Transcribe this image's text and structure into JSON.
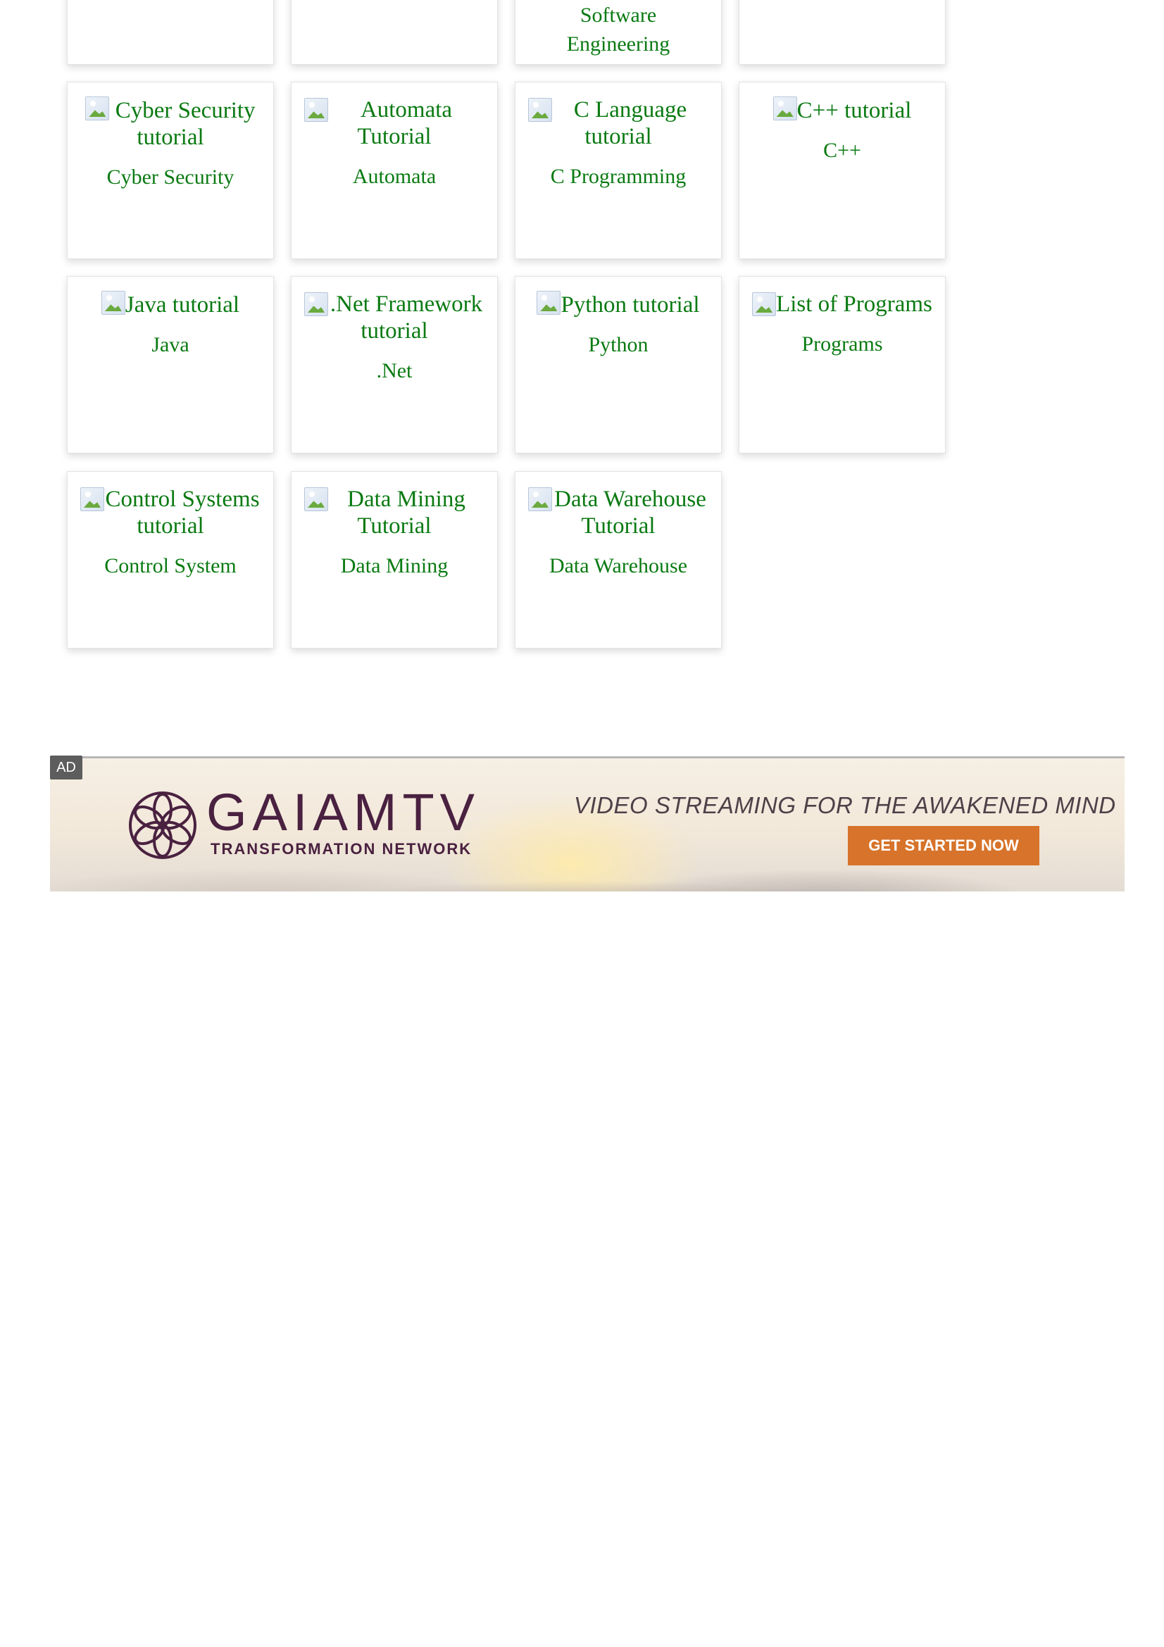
{
  "cards": [
    {
      "img_alt": "",
      "caption": ""
    },
    {
      "img_alt": "",
      "caption": ""
    },
    {
      "img_alt": "",
      "caption": "Software Engineering"
    },
    {
      "img_alt": "",
      "caption": ""
    },
    {
      "img_alt": "Cyber Security tutorial",
      "caption": "Cyber Security"
    },
    {
      "img_alt": "Automata Tutorial",
      "caption": "Automata"
    },
    {
      "img_alt": "C Language tutorial",
      "caption": "C Programming"
    },
    {
      "img_alt": "C++ tutorial",
      "caption": "C++"
    },
    {
      "img_alt": "Java tutorial",
      "caption": "Java"
    },
    {
      "img_alt": ".Net Framework tutorial",
      "caption": ".Net"
    },
    {
      "img_alt": "Python tutorial",
      "caption": "Python"
    },
    {
      "img_alt": "List of Programs",
      "caption": "Programs"
    },
    {
      "img_alt": "Control Systems tutorial",
      "caption": "Control System"
    },
    {
      "img_alt": "Data Mining Tutorial",
      "caption": "Data Mining"
    },
    {
      "img_alt": "Data Warehouse Tutorial",
      "caption": "Data Warehouse"
    }
  ],
  "ad": {
    "badge": "AD",
    "brand": "GAIAMTV",
    "subtitle": "TRANSFORMATION NETWORK",
    "tagline": "VIDEO STREAMING FOR THE AWAKENED MIND",
    "cta": "GET STARTED NOW",
    "brand_color": "#4a2140",
    "cta_color": "#d7732a"
  },
  "colors": {
    "link": "#0a7a12"
  }
}
